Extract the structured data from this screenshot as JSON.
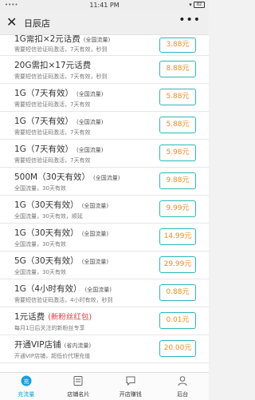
{
  "status": {
    "time": "11:41 PM",
    "left": "••••",
    "battery": "82"
  },
  "nav": {
    "title": "日辰店"
  },
  "products": [
    {
      "name": "1G需扣×2元话费",
      "tag": "(全国流量)",
      "desc": "需要短信验证码激活，7天有效，秒到",
      "price": "3.88元"
    },
    {
      "name": "20G需扣×17元话费",
      "tag": "",
      "desc": "需要短信验证码激活，7天有效，秒到",
      "price": "8.88元"
    },
    {
      "name": "1G（7天有效）",
      "tag": "(全国流量)",
      "desc": "需要短信验证码激活，7天有效",
      "price": "5.88元"
    },
    {
      "name": "1G（7天有效）",
      "tag": "(全国流量)",
      "desc": "需要短信验证码激活，7天有效",
      "price": "5.88元"
    },
    {
      "name": "1G（7天有效）",
      "tag": "(全国流量)",
      "desc": "需要短信验证码激活，7天有效",
      "price": "5.98元"
    },
    {
      "name": "500M（30天有效）",
      "tag": "(全国流量)",
      "desc": "全国流量，30天有效",
      "price": "9.88元"
    },
    {
      "name": "1G（30天有效）",
      "tag": "(全国流量)",
      "desc": "全国流量，30天有效，顺延",
      "price": "9.99元"
    },
    {
      "name": "1G（30天有效）",
      "tag": "(全国流量)",
      "desc": "全国流量，30天有效",
      "price": "14.99元"
    },
    {
      "name": "5G（30天有效）",
      "tag": "(全国流量)",
      "desc": "全国流量，30天有效",
      "price": "29.99元"
    },
    {
      "name": "1G（4小时有效）",
      "tag": "(全国流量)",
      "desc": "需要短信验证码激活，4小时有效，秒到",
      "price": "0.88元"
    },
    {
      "name": "1元话费",
      "tag_red": "(新粉丝红包)",
      "desc": "每月1日后关注的新粉丝专享",
      "price": "0.01元"
    },
    {
      "name": "开通VIP店铺",
      "tag": "(省内流量)",
      "desc": "开通VIP店铺，超低价代理充值",
      "price": "20.00元"
    }
  ],
  "tabs": [
    {
      "label": "充流量",
      "icon": "charge-icon",
      "active": true
    },
    {
      "label": "店铺名片",
      "icon": "card-icon"
    },
    {
      "label": "开店赚钱",
      "icon": "chat-icon"
    },
    {
      "label": "后台",
      "icon": "user-icon"
    }
  ],
  "colors": {
    "accent": "#1a9fe0",
    "price": "#f08b1f",
    "border": "#2db7b5",
    "red_tag": "#e83a3a"
  }
}
